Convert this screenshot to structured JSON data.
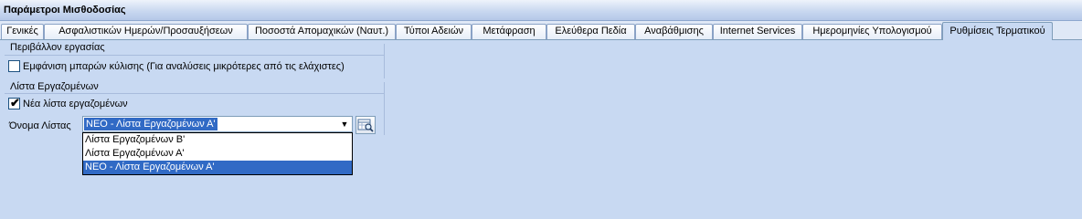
{
  "window": {
    "title": "Παράμετροι Μισθοδοσίας"
  },
  "tabs": [
    {
      "label": "Γενικές"
    },
    {
      "label": "Ασφαλιστικών Ημερών/Προσαυξήσεων"
    },
    {
      "label": "Ποσοστά Απομαχικών (Ναυτ.)"
    },
    {
      "label": "Τύποι Αδειών"
    },
    {
      "label": "Μετάφραση"
    },
    {
      "label": "Ελεύθερα Πεδία"
    },
    {
      "label": "Αναβάθμισης"
    },
    {
      "label": "Internet Services"
    },
    {
      "label": "Ημερομηνίες Υπολογισμού"
    },
    {
      "label": "Ρυθμίσεις Τερματικού"
    }
  ],
  "active_tab": "Ρυθμίσεις Τερματικού",
  "env_group": {
    "label": "Περιβάλλον εργασίας",
    "scrollbars_checkbox": {
      "label": "Εμφάνιση μπαρών κύλισης (Για αναλύσεις μικρότερες από τις ελάχιστες)",
      "checked": false
    }
  },
  "employees_group": {
    "label": "Λίστα Εργαζομένων",
    "new_list_checkbox": {
      "label": "Νέα λίστα εργαζομένων",
      "checked": true,
      "check_glyph": "✔"
    },
    "list_name": {
      "label": "Όνομα Λίστας",
      "value": "ΝΕΟ - Λίστα Εργαζομένων Α'",
      "arrow_glyph": "▼",
      "options": [
        {
          "label": "Λίστα Εργαζομένων Β'"
        },
        {
          "label": "Λίστα Εργαζομένων Α'"
        },
        {
          "label": "ΝΕΟ - Λίστα Εργαζομένων Α'"
        }
      ]
    }
  },
  "colors": {
    "accent": "#316ac5",
    "panel_background": "#c8d9f2"
  }
}
